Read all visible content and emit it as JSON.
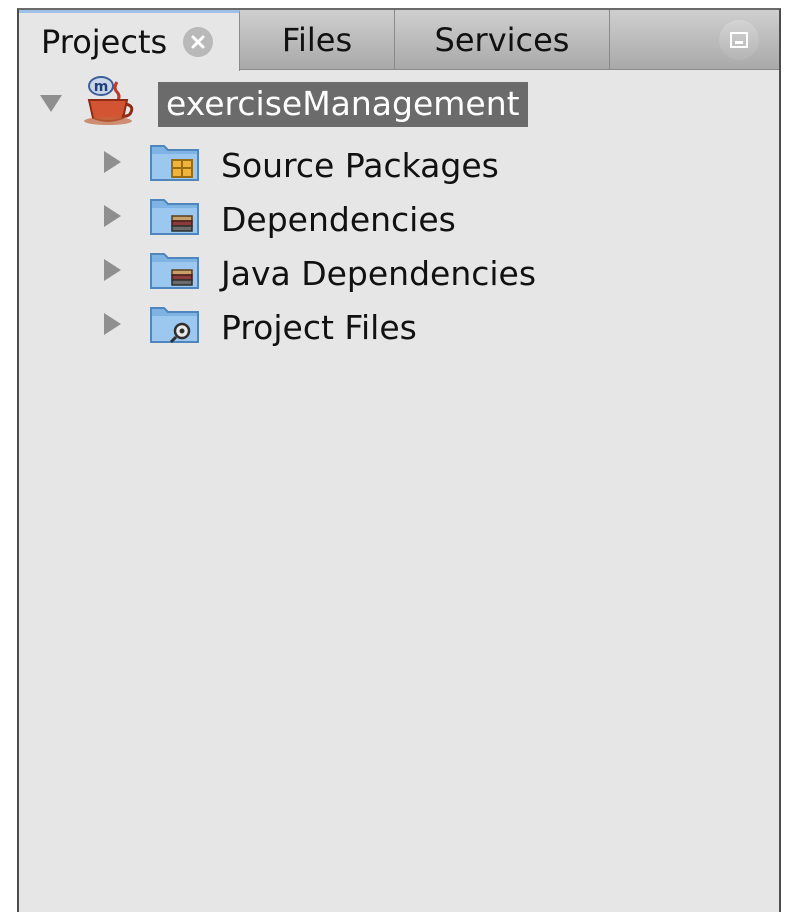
{
  "tabs": [
    {
      "label": "Projects",
      "active": true
    },
    {
      "label": "Files",
      "active": false
    },
    {
      "label": "Services",
      "active": false
    }
  ],
  "tree": {
    "root": {
      "label": "exerciseManagement",
      "icon": "maven-project-icon",
      "expanded": true,
      "selected": true
    },
    "children": [
      {
        "label": "Source Packages",
        "icon": "source-packages-folder-icon"
      },
      {
        "label": "Dependencies",
        "icon": "dependencies-folder-icon"
      },
      {
        "label": "Java Dependencies",
        "icon": "java-dependencies-folder-icon"
      },
      {
        "label": "Project Files",
        "icon": "project-files-folder-icon"
      }
    ]
  },
  "colors": {
    "panel_bg": "#e6e6e6",
    "selection_bg": "#6b6b6b",
    "folder_blue": "#7fb3e3",
    "active_tab_accent": "#9fc0e6"
  }
}
